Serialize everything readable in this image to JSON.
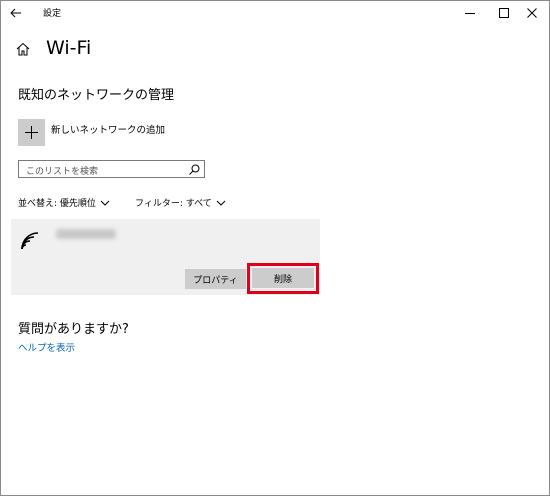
{
  "titlebar": {
    "app_title": "設定",
    "back_icon": "back-arrow-icon",
    "minimize_icon": "minimize-icon",
    "maximize_icon": "maximize-icon",
    "close_icon": "close-icon"
  },
  "header": {
    "home_icon": "home-icon",
    "title": "Wi-Fi"
  },
  "section": {
    "heading": "既知のネットワークの管理",
    "add_network_label": "新しいネットワークの追加"
  },
  "search": {
    "placeholder": "このリストを検索"
  },
  "sort": {
    "label": "並べ替え: 優先順位"
  },
  "filter": {
    "label": "フィルター: すべて"
  },
  "network_card": {
    "wifi_icon": "wifi-signal-icon",
    "properties_label": "プロパティ",
    "delete_label": "削除",
    "highlight_color": "#e0001b"
  },
  "help": {
    "question": "質問がありますか?",
    "link": "ヘルプを表示"
  },
  "colors": {
    "link": "#0066b4",
    "card_bg": "#f0f0f0",
    "button_bg": "#cccccc"
  }
}
